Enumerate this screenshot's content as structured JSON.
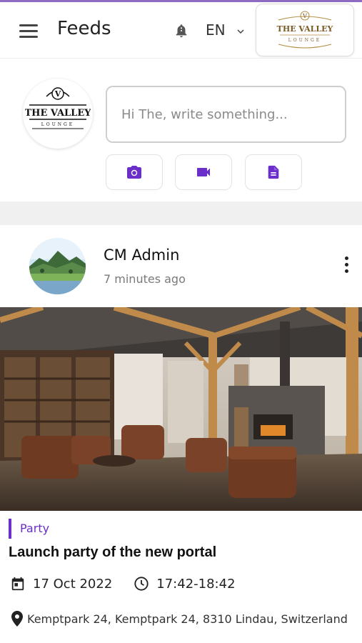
{
  "header": {
    "title": "Feeds",
    "language": "EN",
    "logo_text": "THE VALLEY",
    "logo_subtext": "LOUNGE",
    "logo_letter": "V"
  },
  "composer": {
    "placeholder": "Hi The, write something...",
    "avatar_text": "THE VALLEY",
    "avatar_subtext": "LOUNGE",
    "avatar_letter": "V",
    "buttons": [
      {
        "icon": "camera-icon"
      },
      {
        "icon": "video-icon"
      },
      {
        "icon": "document-icon"
      }
    ]
  },
  "post": {
    "author": "CM Admin",
    "time_ago": "7 minutes ago",
    "category": "Party",
    "title": "Launch party of the new portal",
    "date": "17 Oct 2022",
    "time_range": "17:42-18:42",
    "location": "Kemptpark 24, Kemptpark 24, 8310 Lindau, Switzerland"
  },
  "colors": {
    "accent": "#6a2fc9",
    "top_line": "#8e6bc0",
    "separator": "#f0f0f0"
  }
}
